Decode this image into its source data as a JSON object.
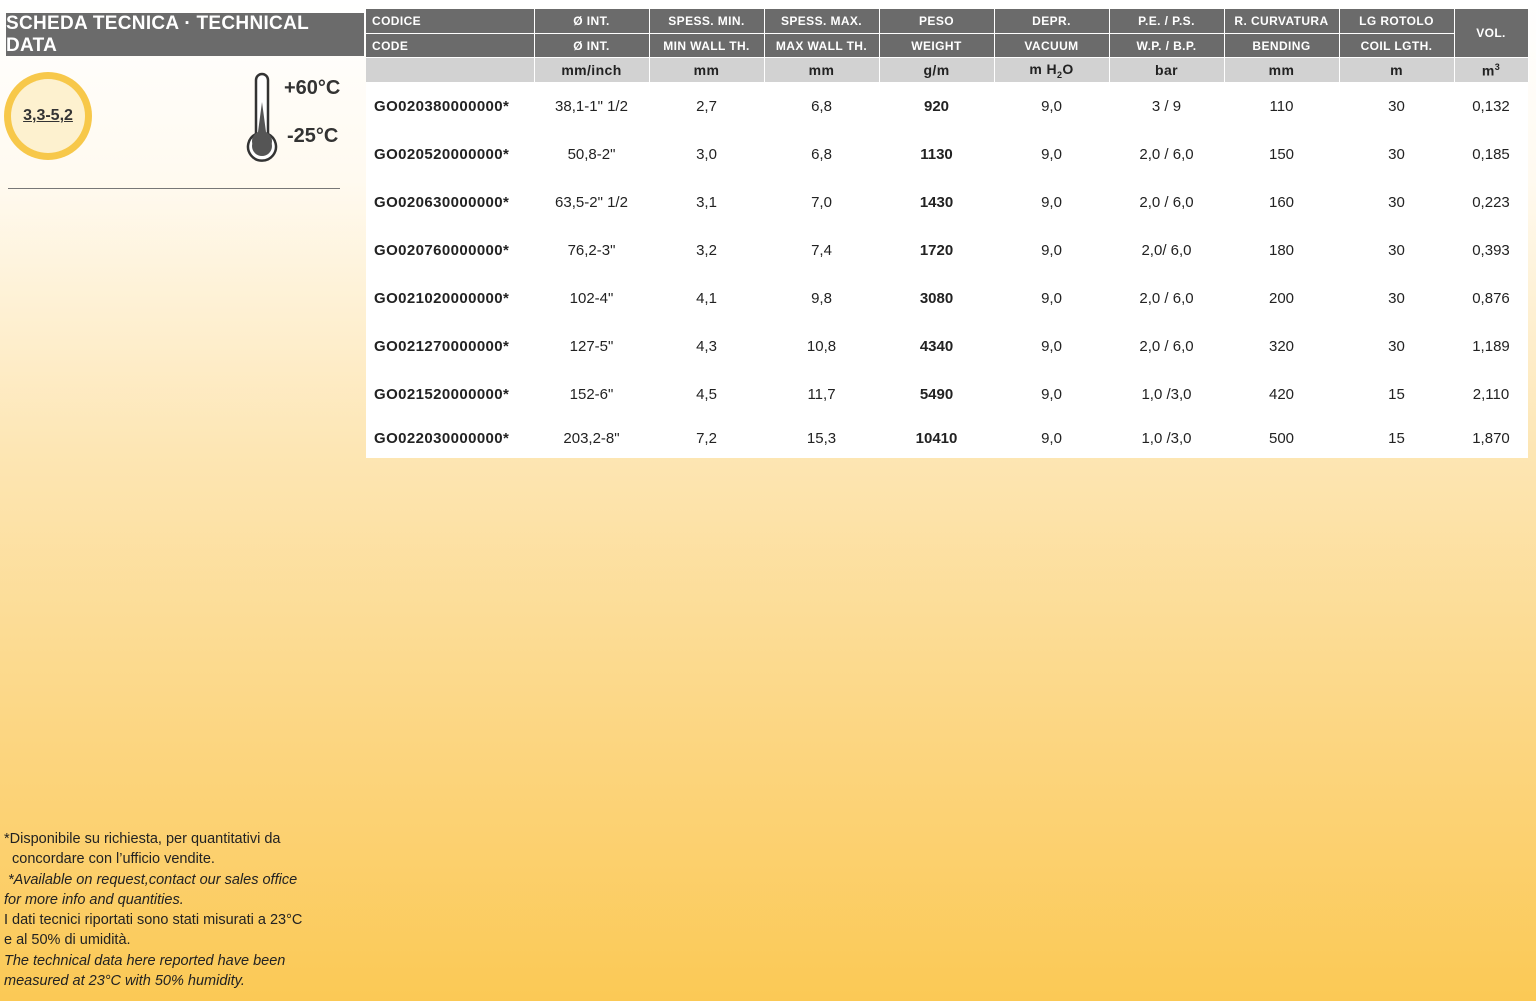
{
  "title": "SCHEDA TECNICA · TECHNICAL DATA",
  "badge": "3,3-5,2",
  "temperature": {
    "max": "+60°C",
    "min": "-25°C"
  },
  "table": {
    "headers_it": [
      "CODICE",
      "Ø INT.",
      "SPESS. MIN.",
      "SPESS. MAX.",
      "PESO",
      "DEPR.",
      "P.E.  /  P.S.",
      "R. CURVATURA",
      "LG ROTOLO",
      "VOL."
    ],
    "headers_en": [
      "CODE",
      "Ø INT.",
      "MIN WALL TH.",
      "MAX WALL TH.",
      "WEIGHT",
      "VACUUM",
      "W.P. / B.P.",
      "BENDING",
      "COIL LGTH."
    ],
    "units": [
      "",
      "mm/inch",
      "mm",
      "mm",
      "g/m",
      "m H",
      "2",
      "O",
      "bar",
      "mm",
      "m",
      "m",
      "3"
    ],
    "rows": [
      [
        "GO020380000000*",
        "38,1-1\" 1/2",
        "2,7",
        "6,8",
        "920",
        "9,0",
        "3  /  9",
        "110",
        "30",
        "0,132"
      ],
      [
        "GO020520000000*",
        "50,8-2\"",
        "3,0",
        "6,8",
        "1130",
        "9,0",
        "2,0  / 6,0",
        "150",
        "30",
        "0,185"
      ],
      [
        "GO020630000000*",
        "63,5-2\" 1/2",
        "3,1",
        "7,0",
        "1430",
        "9,0",
        "2,0 /  6,0",
        "160",
        "30",
        "0,223"
      ],
      [
        "GO020760000000*",
        "76,2-3\"",
        "3,2",
        "7,4",
        "1720",
        "9,0",
        "2,0/  6,0",
        "180",
        "30",
        "0,393"
      ],
      [
        "GO021020000000*",
        "102-4\"",
        "4,1",
        "9,8",
        "3080",
        "9,0",
        "2,0 / 6,0",
        "200",
        "30",
        "0,876"
      ],
      [
        "GO021270000000*",
        "127-5\"",
        "4,3",
        "10,8",
        "4340",
        "9,0",
        "2,0 / 6,0",
        "320",
        "30",
        "1,189"
      ],
      [
        "GO021520000000*",
        "152-6\"",
        "4,5",
        "11,7",
        "5490",
        "9,0",
        "1,0  /3,0",
        "420",
        "15",
        "2,110"
      ],
      [
        "GO022030000000*",
        "203,2-8\"",
        "7,2",
        "15,3",
        "10410",
        "9,0",
        "1,0  /3,0",
        "500",
        "15",
        "1,870"
      ]
    ]
  },
  "notes": [
    "*Disponibile su richiesta, per quantitativi da",
    "  concordare con l’ufficio vendite.",
    " *Available on request,contact our sales office",
    "for more info and quantities.",
    "I dati tecnici riportati sono stati misurati a 23°C",
    "e al 50% di umidità.",
    "The technical data here reported have been",
    "measured at 23°C with 50% humidity."
  ]
}
